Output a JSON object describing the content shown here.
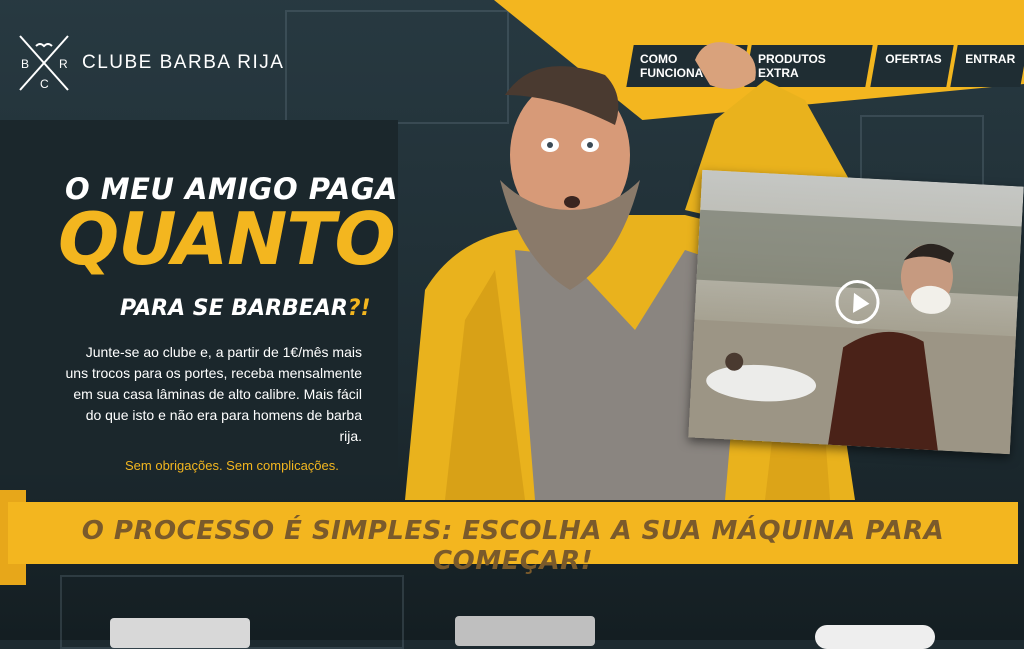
{
  "brand": {
    "name": "CLUBE BARBA RIJA",
    "logo_letters": [
      "B",
      "R",
      "C"
    ]
  },
  "nav": [
    {
      "label": "COMO FUNCIONA"
    },
    {
      "label": "PRODUTOS EXTRA"
    },
    {
      "label": "OFERTAS"
    },
    {
      "label": "ENTRAR"
    }
  ],
  "hero": {
    "line1": "O MEU AMIGO PAGA",
    "line2": "QUANTO",
    "line3": "PARA SE BARBEAR",
    "line3_punct": "?!",
    "body": "Junte-se ao clube e, a partir de 1€/mês mais uns trocos para os portes, receba mensalmente em sua casa lâminas de alto calibre. Mais fácil do que isto e não era para homens de barba rija.",
    "tagline": "Sem obrigações. Sem complicações."
  },
  "video": {
    "play_icon": "play-icon"
  },
  "band": {
    "text": "O PROCESSO É SIMPLES: ESCOLHA A SUA MÁQUINA PARA COMEÇAR!"
  },
  "colors": {
    "accent": "#f3b61f",
    "dark": "#1b272c",
    "band_text": "#7a5a2b"
  }
}
